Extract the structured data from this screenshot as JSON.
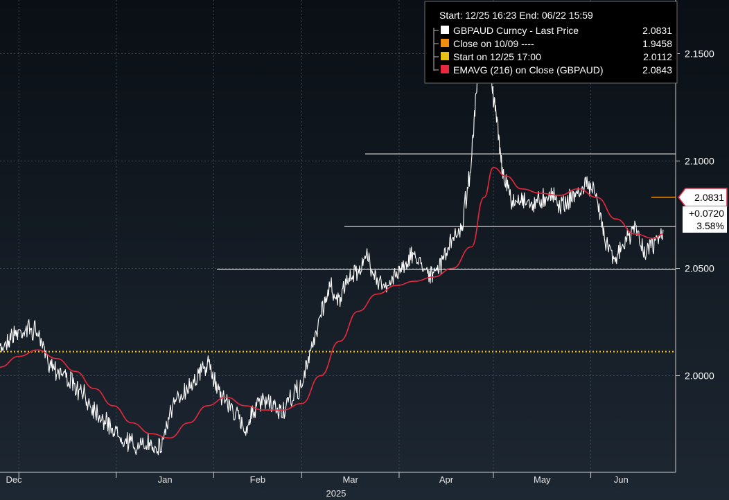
{
  "chart_data": {
    "type": "line",
    "title": "",
    "xlabel": "",
    "ylabel": "",
    "range_label": "Start: 12/25 16:23 End: 06/22 15:59",
    "x_months": [
      {
        "label": "Dec",
        "date": "2024-12-01"
      },
      {
        "label": "Jan",
        "date": "2025-01-01"
      },
      {
        "label": "Feb",
        "date": "2025-02-01"
      },
      {
        "label": "Mar",
        "date": "2025-03-01"
      },
      {
        "label": "Apr",
        "date": "2025-04-01"
      },
      {
        "label": "May",
        "date": "2025-05-01"
      },
      {
        "label": "Jun",
        "date": "2025-06-01"
      }
    ],
    "x_year_label": "2025",
    "xlim": [
      "2024-11-25",
      "2025-06-28"
    ],
    "ylim": [
      1.955,
      2.175
    ],
    "y_ticks": [
      {
        "value": 2.0,
        "label": "2.0000"
      },
      {
        "value": 2.05,
        "label": "2.0500"
      },
      {
        "value": 2.1,
        "label": "2.1000"
      },
      {
        "value": 2.15,
        "label": "2.1500"
      }
    ],
    "grid": true,
    "legend_position": "top-right",
    "series": [
      {
        "name": "GBPAUD Curncy - Last Price",
        "legend_value": "2.0831",
        "color": "#ffffff",
        "points": [
          [
            "2024-11-25",
            2.012
          ],
          [
            "2024-11-28",
            2.018
          ],
          [
            "2024-12-01",
            2.02
          ],
          [
            "2024-12-04",
            2.022
          ],
          [
            "2024-12-07",
            2.02
          ],
          [
            "2024-12-10",
            2.008
          ],
          [
            "2024-12-13",
            2.003
          ],
          [
            "2024-12-16",
            2.0
          ],
          [
            "2024-12-19",
            1.994
          ],
          [
            "2024-12-22",
            1.99
          ],
          [
            "2024-12-25",
            1.985
          ],
          [
            "2024-12-28",
            1.979
          ],
          [
            "2024-12-31",
            1.975
          ],
          [
            "2025-01-03",
            1.971
          ],
          [
            "2025-01-06",
            1.968
          ],
          [
            "2025-01-09",
            1.966
          ],
          [
            "2025-01-12",
            1.969
          ],
          [
            "2025-01-15",
            1.966
          ],
          [
            "2025-01-18",
            1.982
          ],
          [
            "2025-01-21",
            1.99
          ],
          [
            "2025-01-24",
            1.995
          ],
          [
            "2025-01-27",
            2.0
          ],
          [
            "2025-01-30",
            2.006
          ],
          [
            "2025-02-02",
            1.995
          ],
          [
            "2025-02-05",
            1.988
          ],
          [
            "2025-02-08",
            1.982
          ],
          [
            "2025-02-11",
            1.975
          ],
          [
            "2025-02-14",
            1.985
          ],
          [
            "2025-02-17",
            1.988
          ],
          [
            "2025-02-20",
            1.985
          ],
          [
            "2025-02-23",
            1.983
          ],
          [
            "2025-02-26",
            1.99
          ],
          [
            "2025-03-01",
            1.995
          ],
          [
            "2025-03-04",
            2.012
          ],
          [
            "2025-03-07",
            2.028
          ],
          [
            "2025-03-10",
            2.042
          ],
          [
            "2025-03-13",
            2.035
          ],
          [
            "2025-03-16",
            2.045
          ],
          [
            "2025-03-19",
            2.05
          ],
          [
            "2025-03-22",
            2.055
          ],
          [
            "2025-03-25",
            2.045
          ],
          [
            "2025-03-28",
            2.04
          ],
          [
            "2025-03-31",
            2.048
          ],
          [
            "2025-04-03",
            2.053
          ],
          [
            "2025-04-06",
            2.056
          ],
          [
            "2025-04-09",
            2.051
          ],
          [
            "2025-04-12",
            2.046
          ],
          [
            "2025-04-15",
            2.055
          ],
          [
            "2025-04-18",
            2.063
          ],
          [
            "2025-04-21",
            2.07
          ],
          [
            "2025-04-24",
            2.1
          ],
          [
            "2025-04-26",
            2.14
          ],
          [
            "2025-04-28",
            2.16
          ],
          [
            "2025-04-30",
            2.14
          ],
          [
            "2025-05-02",
            2.12
          ],
          [
            "2025-05-04",
            2.095
          ],
          [
            "2025-05-07",
            2.08
          ],
          [
            "2025-05-10",
            2.083
          ],
          [
            "2025-05-13",
            2.08
          ],
          [
            "2025-05-16",
            2.082
          ],
          [
            "2025-05-19",
            2.085
          ],
          [
            "2025-05-22",
            2.08
          ],
          [
            "2025-05-25",
            2.082
          ],
          [
            "2025-05-28",
            2.085
          ],
          [
            "2025-05-31",
            2.09
          ],
          [
            "2025-06-03",
            2.082
          ],
          [
            "2025-06-06",
            2.062
          ],
          [
            "2025-06-09",
            2.055
          ],
          [
            "2025-06-12",
            2.062
          ],
          [
            "2025-06-15",
            2.07
          ],
          [
            "2025-06-18",
            2.058
          ],
          [
            "2025-06-21",
            2.06
          ],
          [
            "2025-06-24",
            2.068
          ]
        ]
      },
      {
        "name": "Close on 10/09 ----",
        "legend_value": "1.9458",
        "color": "#f28c0f"
      },
      {
        "name": "Start on 12/25 17:00",
        "legend_value": "2.0112",
        "color": "#e6c212",
        "value": 2.0112
      },
      {
        "name": "EMAVG (216)  on Close (GBPAUD)",
        "legend_value": "2.0843",
        "color": "#e8283c",
        "points": [
          [
            "2024-11-25",
            2.004
          ],
          [
            "2024-12-01",
            2.009
          ],
          [
            "2024-12-07",
            2.012
          ],
          [
            "2024-12-13",
            2.008
          ],
          [
            "2024-12-19",
            2.002
          ],
          [
            "2024-12-25",
            1.994
          ],
          [
            "2024-12-31",
            1.986
          ],
          [
            "2025-01-06",
            1.978
          ],
          [
            "2025-01-12",
            1.973
          ],
          [
            "2025-01-18",
            1.971
          ],
          [
            "2025-01-24",
            1.978
          ],
          [
            "2025-01-30",
            1.986
          ],
          [
            "2025-02-05",
            1.99
          ],
          [
            "2025-02-11",
            1.986
          ],
          [
            "2025-02-17",
            1.984
          ],
          [
            "2025-02-23",
            1.984
          ],
          [
            "2025-03-01",
            1.987
          ],
          [
            "2025-03-07",
            2.0
          ],
          [
            "2025-03-13",
            2.016
          ],
          [
            "2025-03-19",
            2.03
          ],
          [
            "2025-03-25",
            2.038
          ],
          [
            "2025-03-31",
            2.042
          ],
          [
            "2025-04-06",
            2.044
          ],
          [
            "2025-04-12",
            2.046
          ],
          [
            "2025-04-18",
            2.05
          ],
          [
            "2025-04-24",
            2.06
          ],
          [
            "2025-04-28",
            2.083
          ],
          [
            "2025-05-01",
            2.097
          ],
          [
            "2025-05-05",
            2.093
          ],
          [
            "2025-05-10",
            2.087
          ],
          [
            "2025-05-16",
            2.085
          ],
          [
            "2025-05-22",
            2.084
          ],
          [
            "2025-05-28",
            2.087
          ],
          [
            "2025-06-03",
            2.083
          ],
          [
            "2025-06-09",
            2.073
          ],
          [
            "2025-06-15",
            2.066
          ],
          [
            "2025-06-21",
            2.064
          ],
          [
            "2025-06-24",
            2.066
          ]
        ]
      }
    ],
    "reference_lines": [
      2.1033,
      2.0695,
      2.0495
    ],
    "last_price_box": {
      "price": "2.0831",
      "change": "+0.0720",
      "percent": "3.58%"
    }
  },
  "colors": {
    "background_top": "#0a0f15",
    "background_bottom": "#1d2732",
    "grid": "#3d4a56",
    "legend_bg": "#000000",
    "legend_border": "#6b6b6b"
  }
}
